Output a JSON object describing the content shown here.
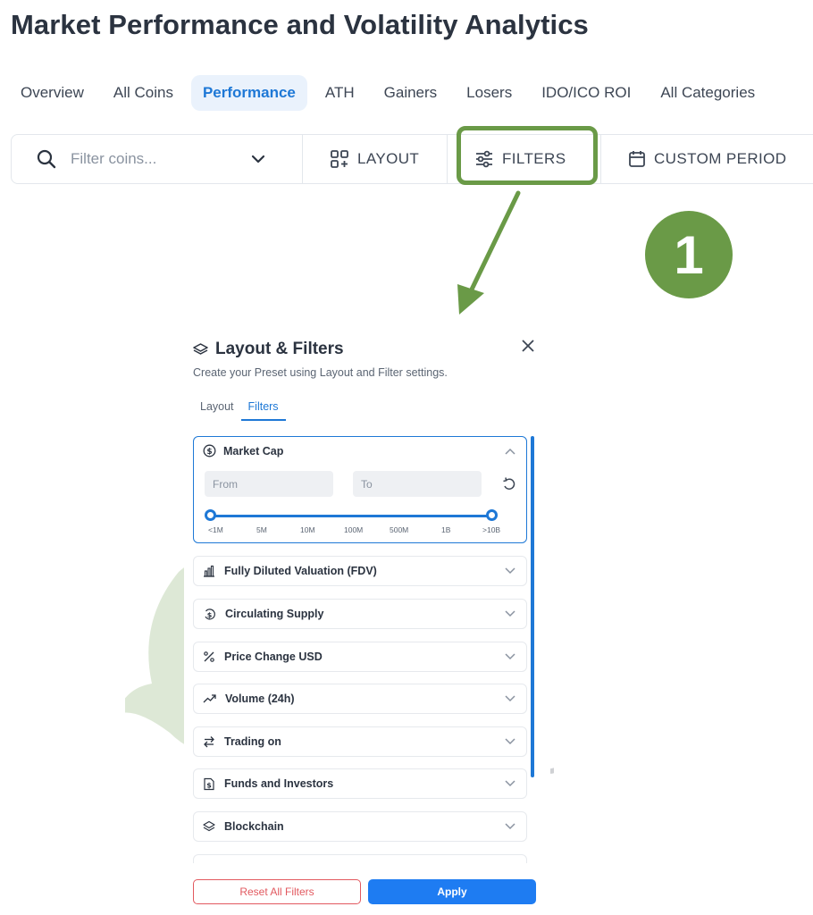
{
  "page_title": "Market Performance and Volatility Analytics",
  "tabs": [
    {
      "label": "Overview",
      "active": false
    },
    {
      "label": "All Coins",
      "active": false
    },
    {
      "label": "Performance",
      "active": true
    },
    {
      "label": "ATH",
      "active": false
    },
    {
      "label": "Gainers",
      "active": false
    },
    {
      "label": "Losers",
      "active": false
    },
    {
      "label": "IDO/ICO ROI",
      "active": false
    },
    {
      "label": "All Categories",
      "active": false
    }
  ],
  "toolbar": {
    "search_placeholder": "Filter coins...",
    "layout_label": "LAYOUT",
    "filters_label": "FILTERS",
    "custom_period_label": "CUSTOM PERIOD"
  },
  "annotation": {
    "step_number": "1",
    "highlight_color": "#6a9a47"
  },
  "panel": {
    "title": "Layout & Filters",
    "subtitle": "Create your Preset using Layout and Filter settings.",
    "tabs": [
      {
        "label": "Layout",
        "active": false
      },
      {
        "label": "Filters",
        "active": true
      }
    ],
    "market_cap": {
      "label": "Market Cap",
      "from_placeholder": "From",
      "to_placeholder": "To",
      "ticks": [
        "<1M",
        "5M",
        "10M",
        "100M",
        "500M",
        "1B",
        ">10B"
      ]
    },
    "filters": [
      {
        "label": "Fully Diluted Valuation (FDV)",
        "icon": "chart-bar-icon"
      },
      {
        "label": "Circulating Supply",
        "icon": "dollar-cycle-icon"
      },
      {
        "label": "Price Change USD",
        "icon": "percent-icon"
      },
      {
        "label": "Volume (24h)",
        "icon": "trend-up-icon"
      },
      {
        "label": "Trading on",
        "icon": "swap-icon"
      },
      {
        "label": "Funds and Investors",
        "icon": "dollar-doc-icon"
      },
      {
        "label": "Blockchain",
        "icon": "layers-icon"
      }
    ],
    "reset_label": "Reset All Filters",
    "apply_label": "Apply"
  },
  "colors": {
    "accent": "#1e78d6",
    "apply": "#1e7cf2",
    "reset": "#e2595f",
    "annotation_green": "#6a9a47"
  }
}
